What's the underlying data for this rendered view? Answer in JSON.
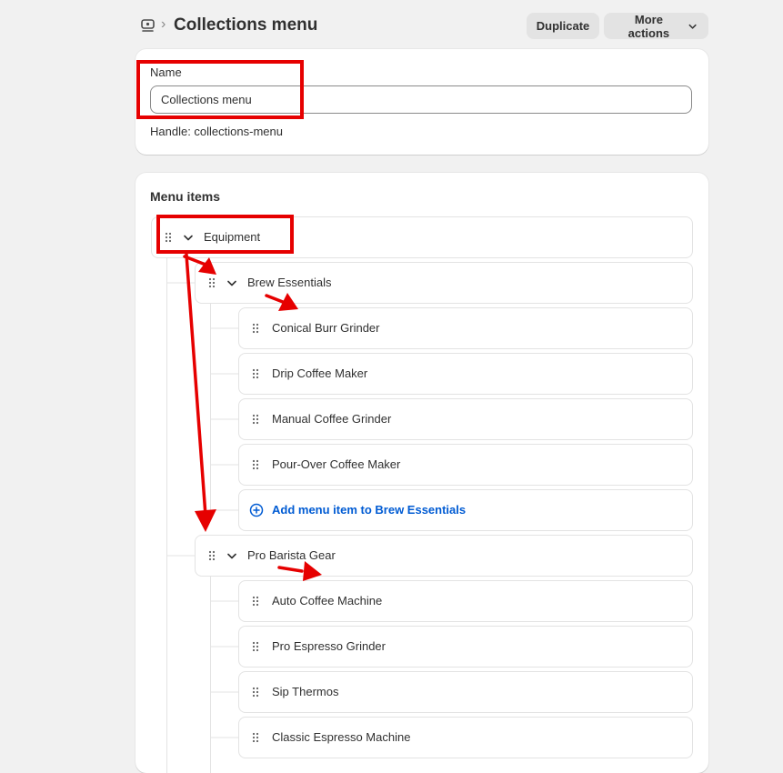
{
  "header": {
    "title": "Collections menu",
    "separator": "›",
    "duplicate_label": "Duplicate",
    "more_actions_label": "More actions"
  },
  "name_card": {
    "label": "Name",
    "value": "Collections menu",
    "handle_text": "Handle: collections-menu"
  },
  "menu": {
    "title": "Menu items",
    "root": {
      "label": "Equipment"
    },
    "groups": [
      {
        "label": "Brew Essentials",
        "items": [
          "Conical Burr Grinder",
          "Drip Coffee Maker",
          "Manual Coffee Grinder",
          "Pour-Over Coffee Maker"
        ],
        "add_label": "Add menu item to Brew Essentials"
      },
      {
        "label": "Pro Barista Gear",
        "items": [
          "Auto Coffee Machine",
          "Pro Espresso Grinder",
          "Sip Thermos",
          "Classic Espresso Machine"
        ]
      }
    ]
  },
  "colors": {
    "annotation": "#e60000",
    "link": "#005bd3"
  }
}
